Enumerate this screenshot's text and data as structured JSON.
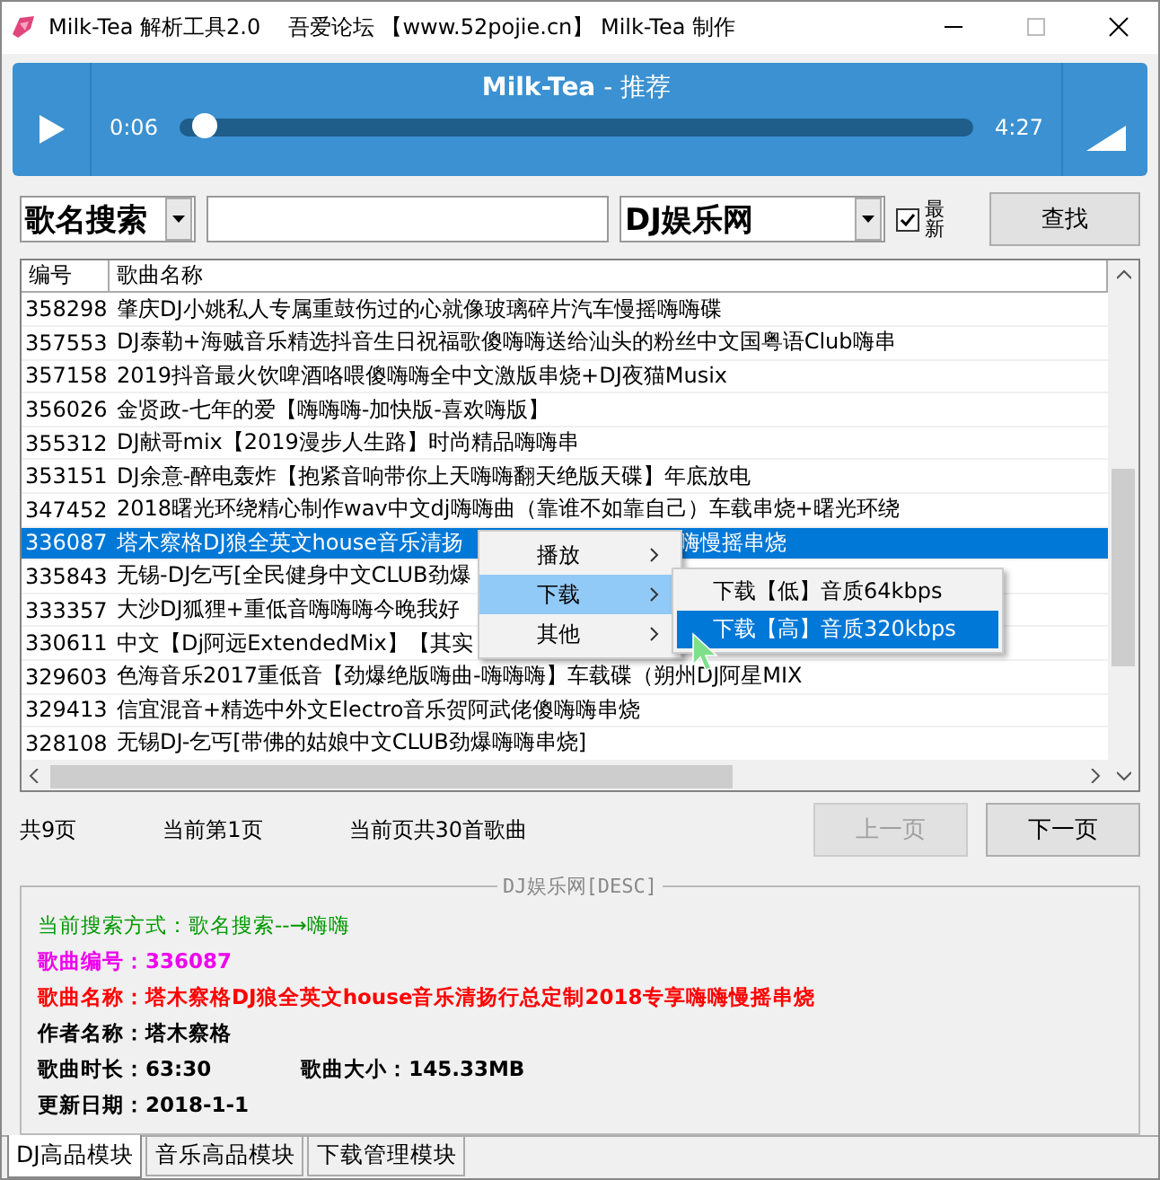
{
  "window": {
    "title": "Milk-Tea 解析工具2.0    吾爱论坛 【www.52pojie.cn】 Milk-Tea 制作"
  },
  "player": {
    "title_bold": "Milk-Tea",
    "title_rest": " - 推荐",
    "elapsed": "0:06",
    "total": "4:27",
    "level": 0.02
  },
  "search": {
    "mode": "歌名搜索",
    "source": "DJ娱乐网",
    "newest_label": "最新",
    "newest_checked": true,
    "button": "查找"
  },
  "table": {
    "columns": [
      "编号",
      "歌曲名称"
    ],
    "rows": [
      {
        "id": "358298",
        "name": "肇庆DJ小姚私人专属重鼓伤过的心就像玻璃碎片汽车慢摇嗨嗨碟",
        "selected": false
      },
      {
        "id": "357553",
        "name": "DJ泰勒+海贼音乐精选抖音生日祝福歌傻嗨嗨送给汕头的粉丝中文国粤语Club嗨串",
        "selected": false
      },
      {
        "id": "357158",
        "name": "2019抖音最火饮啤酒咯喂傻嗨嗨全中文激版串烧+DJ夜猫Musix",
        "selected": false
      },
      {
        "id": "356026",
        "name": "金贤政-七年的爱【嗨嗨嗨-加快版-喜欢嗨版】",
        "selected": false
      },
      {
        "id": "355312",
        "name": "DJ献哥mix【2019漫步人生路】时尚精品嗨嗨串",
        "selected": false
      },
      {
        "id": "353151",
        "name": "DJ余意-醉电轰炸【抱紧音响带你上天嗨嗨翻天绝版天碟】年底放电",
        "selected": false
      },
      {
        "id": "347452",
        "name": "2018曙光环绕精心制作wav中文dj嗨嗨曲（靠谁不如靠自己）车载串烧+曙光环绕",
        "selected": false
      },
      {
        "id": "336087",
        "name": "塔木察格DJ狼全英文house音乐清扬",
        "name_after": "嗨慢摇串烧",
        "selected": true
      },
      {
        "id": "335843",
        "name": "无锡-DJ乞丐[全民健身中文CLUB劲爆",
        "selected": false
      },
      {
        "id": "333357",
        "name": "大沙DJ狐狸+重低音嗨嗨嗨今晚我好",
        "selected": false
      },
      {
        "id": "330611",
        "name": "中文【Dj阿远ExtendedMix】【其实",
        "selected": false
      },
      {
        "id": "329603",
        "name": "色海音乐2017重低音【劲爆绝版嗨曲-嗨嗨嗨】车载碟（朔州DJ阿星MIX",
        "selected": false
      },
      {
        "id": "329413",
        "name": "信宜混音+精选中外文Electro音乐贺阿武佬傻嗨嗨串烧",
        "selected": false
      },
      {
        "id": "328108",
        "name": "无锡DJ-乞丐[带佛的姑娘中文CLUB劲爆嗨嗨串烧]",
        "selected": false
      }
    ]
  },
  "context_menu": {
    "items": [
      {
        "label": "播放",
        "selected": false
      },
      {
        "label": "下载",
        "selected": true
      },
      {
        "label": "其他",
        "selected": false
      }
    ],
    "submenu": [
      {
        "label": "下载【低】音质64kbps",
        "selected": false
      },
      {
        "label": "下载【高】音质320kbps",
        "selected": true
      }
    ]
  },
  "paging": {
    "total_pages": "共9页",
    "current_page": "当前第1页",
    "songs_on_page": "当前页共30首歌曲",
    "prev": "上一页",
    "prev_disabled": true,
    "next": "下一页"
  },
  "details": {
    "title": "DJ娱乐网[DESC]",
    "lines": [
      {
        "kind": "method",
        "text": "当前搜索方式：歌名搜索--→嗨嗨"
      },
      {
        "kind": "id",
        "text": "歌曲编号：336087"
      },
      {
        "kind": "name",
        "text": "歌曲名称：塔木察格DJ狼全英文house音乐清扬行总定制2018专享嗨嗨慢摇串烧"
      },
      {
        "kind": "plain",
        "text": "作者名称：塔木察格"
      },
      {
        "kind": "pair",
        "text": "歌曲时长：63:30",
        "text2": "歌曲大小：145.33MB"
      },
      {
        "kind": "plain",
        "text": "更新日期：2018-1-1"
      }
    ]
  },
  "tabs": [
    {
      "label": "DJ高品模块",
      "selected": true
    },
    {
      "label": "音乐高品模块",
      "selected": false
    },
    {
      "label": "下载管理模块",
      "selected": false
    }
  ]
}
